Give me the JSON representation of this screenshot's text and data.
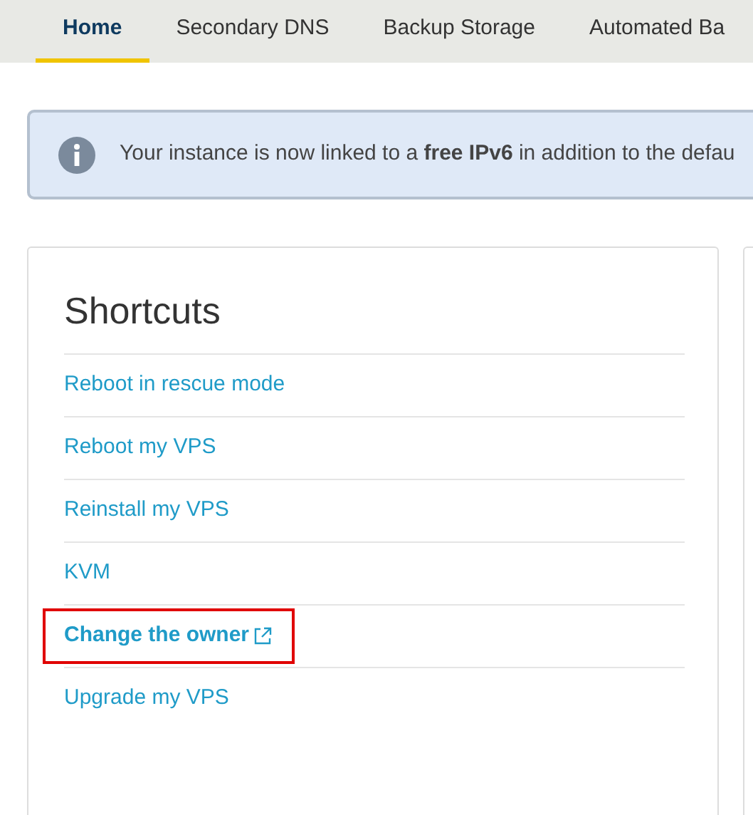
{
  "tabs": [
    {
      "label": "Home",
      "selected": true
    },
    {
      "label": "Secondary DNS",
      "selected": false
    },
    {
      "label": "Backup Storage",
      "selected": false
    },
    {
      "label": "Automated Ba",
      "selected": false
    }
  ],
  "alert": {
    "text": "Your instance is now linked to a **free IPv6** in addition to the defau"
  },
  "shortcuts": {
    "title": "Shortcuts",
    "items": [
      {
        "label": "Reboot in rescue mode",
        "external": false,
        "highlighted": false
      },
      {
        "label": "Reboot my VPS",
        "external": false,
        "highlighted": false
      },
      {
        "label": "Reinstall my VPS",
        "external": false,
        "highlighted": false
      },
      {
        "label": "KVM",
        "external": false,
        "highlighted": false
      },
      {
        "label": "Change the owner",
        "external": true,
        "highlighted": true
      },
      {
        "label": "Upgrade my VPS",
        "external": false,
        "highlighted": false
      }
    ]
  }
}
